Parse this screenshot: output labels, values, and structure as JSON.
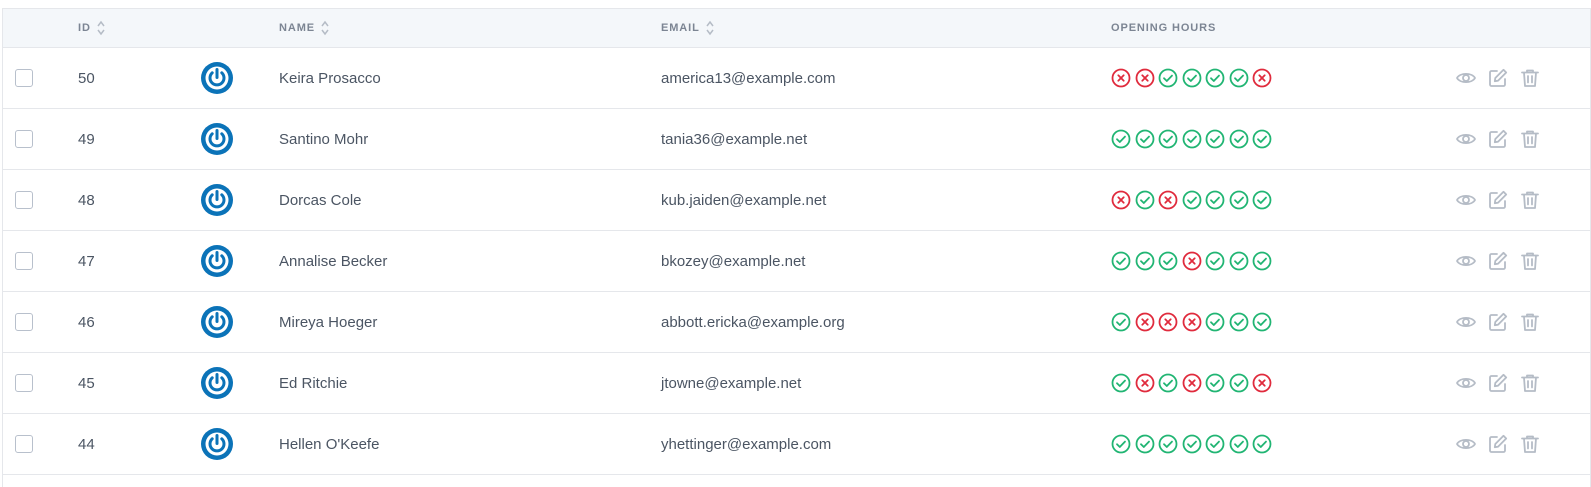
{
  "table": {
    "headers": {
      "id": "ID",
      "name": "NAME",
      "email": "EMAIL",
      "opening_hours": "OPENING HOURS"
    },
    "rows": [
      {
        "id": "50",
        "name": "Keira Prosacco",
        "email": "america13@example.com",
        "hours": [
          false,
          false,
          true,
          true,
          true,
          true,
          false
        ]
      },
      {
        "id": "49",
        "name": "Santino Mohr",
        "email": "tania36@example.net",
        "hours": [
          true,
          true,
          true,
          true,
          true,
          true,
          true
        ]
      },
      {
        "id": "48",
        "name": "Dorcas Cole",
        "email": "kub.jaiden@example.net",
        "hours": [
          false,
          true,
          false,
          true,
          true,
          true,
          true
        ]
      },
      {
        "id": "47",
        "name": "Annalise Becker",
        "email": "bkozey@example.net",
        "hours": [
          true,
          true,
          true,
          false,
          true,
          true,
          true
        ]
      },
      {
        "id": "46",
        "name": "Mireya Hoeger",
        "email": "abbott.ericka@example.org",
        "hours": [
          true,
          false,
          false,
          false,
          true,
          true,
          true
        ]
      },
      {
        "id": "45",
        "name": "Ed Ritchie",
        "email": "jtowne@example.net",
        "hours": [
          true,
          false,
          true,
          false,
          true,
          true,
          false
        ]
      },
      {
        "id": "44",
        "name": "Hellen O'Keefe",
        "email": "yhettinger@example.com",
        "hours": [
          true,
          true,
          true,
          true,
          true,
          true,
          true
        ]
      }
    ]
  },
  "colors": {
    "open": "#21b573",
    "closed": "#e02b3d",
    "avatar": "#0b73b8",
    "action_icon": "#b5bcc6"
  },
  "icons": {
    "avatar": "power-icon",
    "open": "check-circle-icon",
    "closed": "x-circle-icon",
    "view": "eye-icon",
    "edit": "edit-icon",
    "delete": "trash-icon",
    "sort": "sort-icon"
  }
}
